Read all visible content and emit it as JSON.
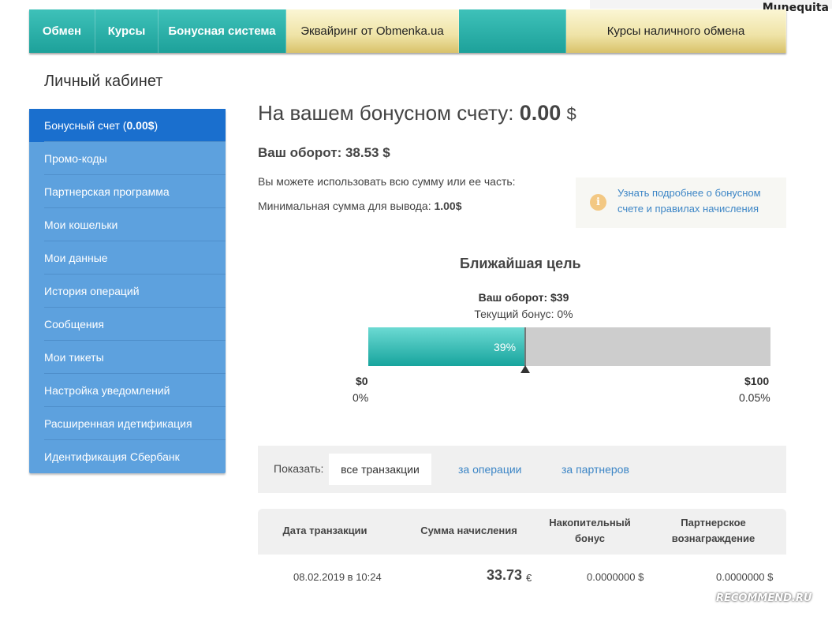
{
  "corner_user": "Munequita",
  "nav": {
    "items": [
      "Обмен",
      "Курсы",
      "Бонусная система"
    ],
    "acquiring": "Эквайринг от Obmenka.ua",
    "cash_rates": "Курсы наличного обмена"
  },
  "page_title": "Личный кабинет",
  "sidebar": {
    "active_label": "Бонусный счет (",
    "active_amount": "0.00$",
    "active_suffix": ")",
    "items": [
      "Промо-коды",
      "Партнерская программа",
      "Мои кошельки",
      "Мои данные",
      "История операций",
      "Сообщения",
      "Мои тикеты",
      "Настройка уведомлений",
      "Расширенная идетификация",
      "Идентификация Сбербанк"
    ]
  },
  "main": {
    "bonus_label": "На вашем бонусном счету:",
    "bonus_value": "0.00",
    "bonus_currency": "$",
    "turnover": "Ваш оборот: 38.53 $",
    "use_text": "Вы можете использовать всю сумму или ее часть:",
    "min_label": "Минимальная сумма для вывода:",
    "min_value": "1.00$",
    "info_icon": "info-icon",
    "info_link": "Узнать подробнее о бонусном счете и правилах начисления"
  },
  "goal": {
    "title": "Ближайшая цель",
    "turnover_label": "Ваш оборот: $39",
    "bonus_label": "Текущий бонус: 0%",
    "progress_percent": 39,
    "progress_label": "39%",
    "min_amount": "$0",
    "min_pct": "0%",
    "max_amount": "$100",
    "max_pct": "0.05%"
  },
  "filter": {
    "label": "Показать:",
    "active": "все транзакции",
    "options": [
      "за операции",
      "за партнеров"
    ]
  },
  "table": {
    "headers": [
      "Дата транзакции",
      "Сумма начисления",
      "Накопительный бонус",
      "Партнерское вознаграждение"
    ],
    "rows": [
      {
        "date": "08.02.2019 в 10:24",
        "amount": "33.73",
        "currency": "€",
        "cumulative": "0.0000000 $",
        "partner": "0.0000000 $"
      }
    ]
  },
  "watermark": "RECOMMEND.RU",
  "colors": {
    "nav_teal": "#1da19a",
    "nav_gold": "#efe3a6",
    "sidebar_bg": "#5da1de",
    "sidebar_active": "#1a6fce",
    "progress_fill": "#17a49d",
    "link": "#3d86c6"
  }
}
